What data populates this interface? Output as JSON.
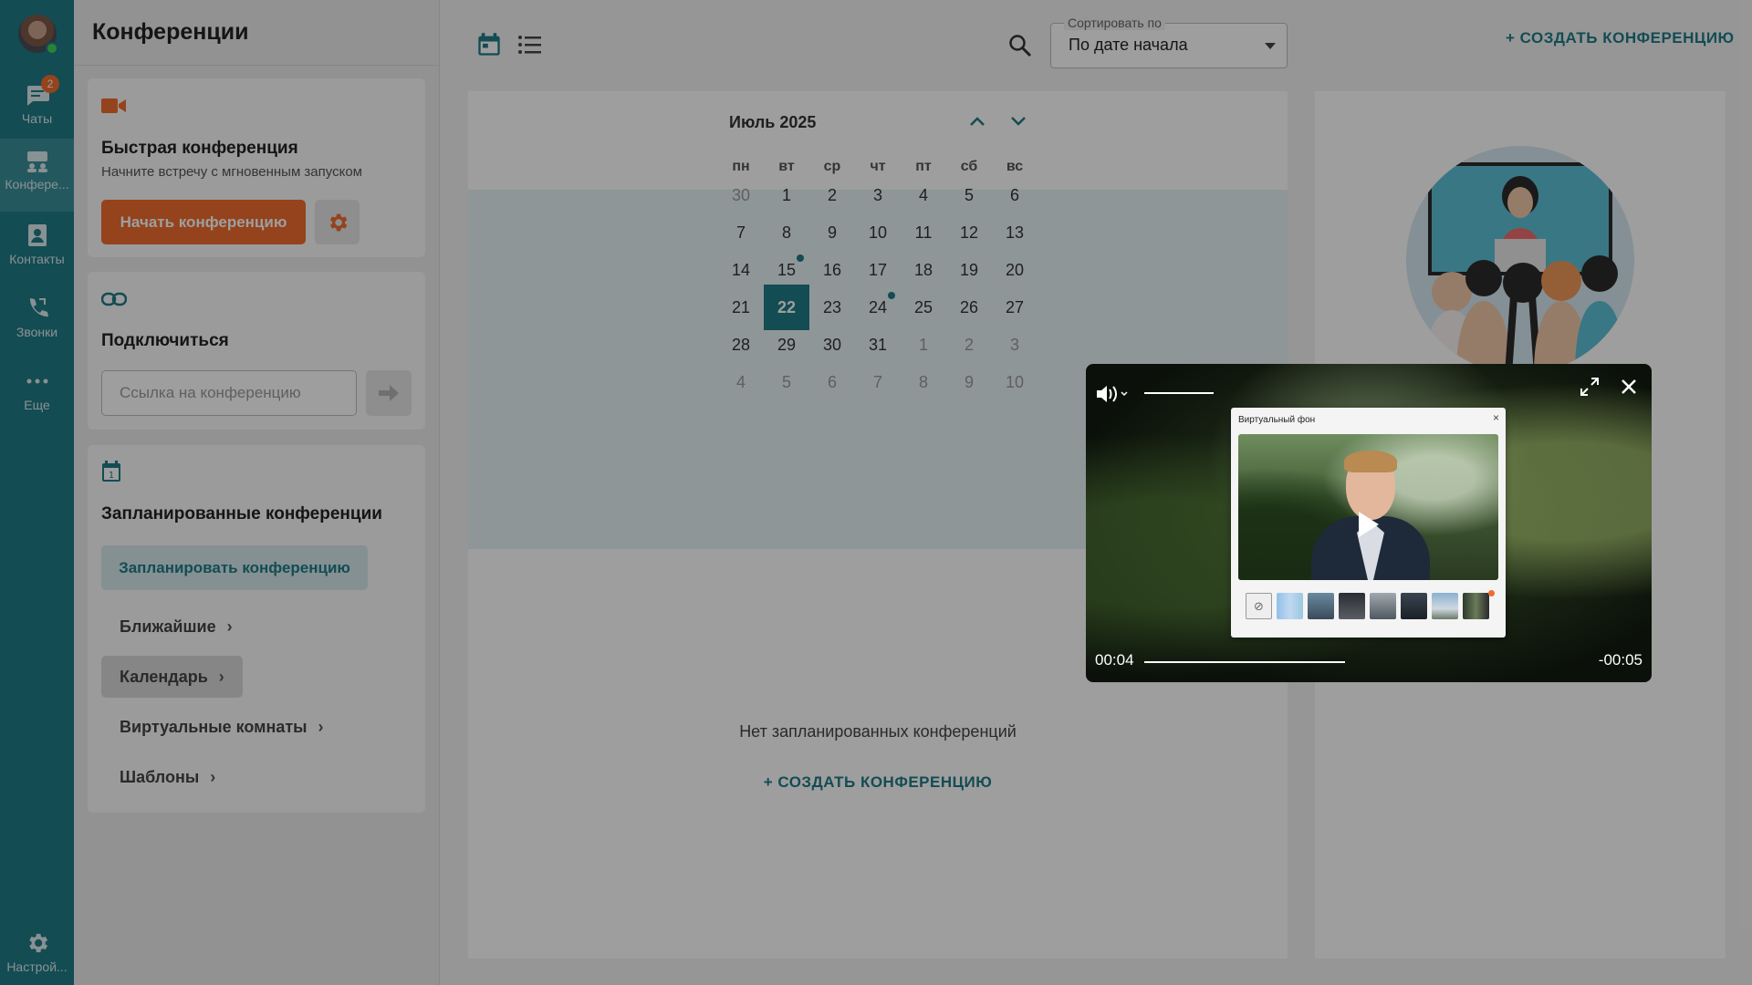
{
  "sidebar": {
    "chats_badge": "2",
    "items": [
      {
        "label": "Чаты"
      },
      {
        "label": "Конфере..."
      },
      {
        "label": "Контакты"
      },
      {
        "label": "Звонки"
      },
      {
        "label": "Еще"
      }
    ],
    "settings_label": "Настрой..."
  },
  "left": {
    "title": "Конференции",
    "quick": {
      "title": "Быстрая конференция",
      "subtitle": "Начните встречу с мгновенным запуском",
      "start_button": "Начать конференцию"
    },
    "connect": {
      "title": "Подключиться",
      "placeholder": "Ссылка на конференцию"
    },
    "scheduled": {
      "title": "Запланированные конференции",
      "plan_button": "Запланировать конференцию",
      "nav": [
        "Ближайшие",
        "Календарь",
        "Виртуальные комнаты",
        "Шаблоны"
      ]
    }
  },
  "topbar": {
    "sort_label": "Сортировать по",
    "sort_value": "По дате начала",
    "create": "+ СОЗДАТЬ КОНФЕРЕНЦИЮ"
  },
  "calendar": {
    "month": "Июль 2025",
    "weekdays": [
      "пн",
      "вт",
      "ср",
      "чт",
      "пт",
      "сб",
      "вс"
    ],
    "weeks": [
      [
        "30",
        "1",
        "2",
        "3",
        "4",
        "5",
        "6"
      ],
      [
        "7",
        "8",
        "9",
        "10",
        "11",
        "12",
        "13"
      ],
      [
        "14",
        "15",
        "16",
        "17",
        "18",
        "19",
        "20"
      ],
      [
        "21",
        "22",
        "23",
        "24",
        "25",
        "26",
        "27"
      ],
      [
        "28",
        "29",
        "30",
        "31",
        "1",
        "2",
        "3"
      ],
      [
        "4",
        "5",
        "6",
        "7",
        "8",
        "9",
        "10"
      ]
    ],
    "today": "22",
    "marked_days": [
      "15",
      "24"
    ],
    "empty_message": "Нет запланированных конференций",
    "create_bottom": "+ СОЗДАТЬ КОНФЕРЕНЦИЮ"
  },
  "player": {
    "elapsed": "00:04",
    "remaining": "-00:05",
    "progress": 0.44,
    "volume": 1.0,
    "vb_title": "Виртуальный фон",
    "vb_close": "×"
  },
  "colors": {
    "accent": "#1f7b86",
    "orange": "#ef6c2e"
  }
}
